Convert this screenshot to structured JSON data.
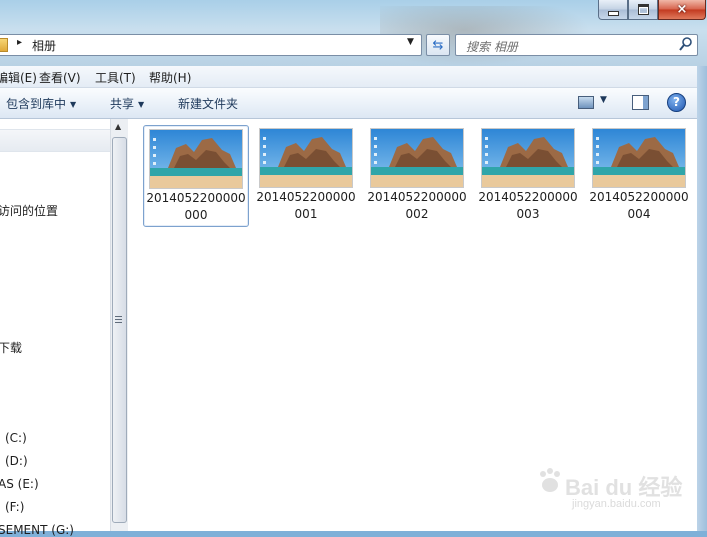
{
  "window": {
    "caption_minimize": "minimize",
    "caption_maximize": "maximize",
    "caption_close": "×"
  },
  "address": {
    "breadcrumb": "相册",
    "separator": "▸",
    "dropdown": "▼"
  },
  "search": {
    "placeholder": "搜索 相册"
  },
  "menu": [
    "编辑(E)",
    "查看(V)",
    "工具(T)",
    "帮助(H)"
  ],
  "commands": {
    "include_library": "包含到库中",
    "share": "共享",
    "new_folder": "新建文件夹",
    "dropdown_glyph": "▼",
    "help_glyph": "?"
  },
  "nav": {
    "recent_places": "访问的位置",
    "downloads": "下载",
    "drive_c": "(C:)",
    "drive_d": "(D:)",
    "drive_e": "AS (E:)",
    "drive_f": "(F:)",
    "drive_g": "SEMENT (G:)"
  },
  "files": [
    {
      "name": "2014052200000000"
    },
    {
      "name": "2014052200000001"
    },
    {
      "name": "2014052200000002"
    },
    {
      "name": "2014052200000003"
    },
    {
      "name": "2014052200000004"
    }
  ],
  "watermark": {
    "brand": "Bai du 经验",
    "url": "jingyan.baidu.com"
  }
}
